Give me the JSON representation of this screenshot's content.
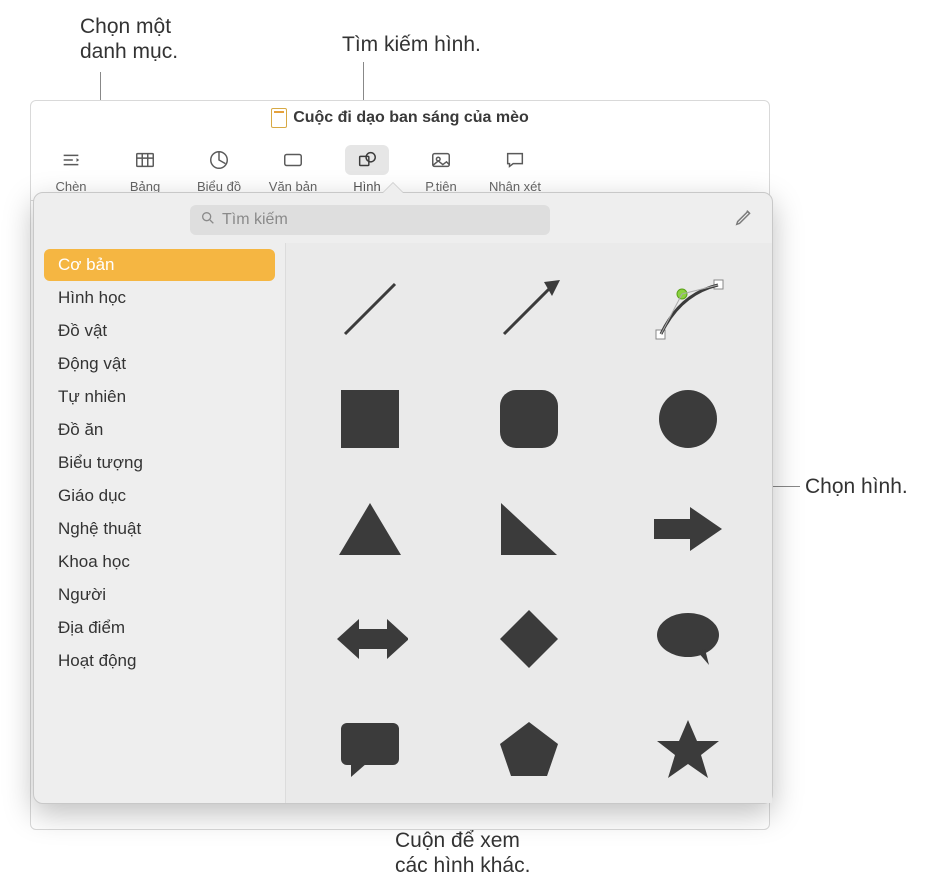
{
  "callouts": {
    "category": "Chọn một\ndanh mục.",
    "search": "Tìm kiếm hình.",
    "choose": "Chọn hình.",
    "scroll": "Cuộn để xem\ncác hình khác."
  },
  "document_title": "Cuộc đi dạo ban sáng của mèo",
  "toolbar": {
    "insert": "Chèn",
    "table": "Bảng",
    "chart": "Biểu đồ",
    "text": "Văn bản",
    "shape": "Hình",
    "media": "P.tiện",
    "comment": "Nhận xét"
  },
  "search": {
    "placeholder": "Tìm kiếm"
  },
  "categories": [
    "Cơ bản",
    "Hình học",
    "Đồ vật",
    "Động vật",
    "Tự nhiên",
    "Đồ ăn",
    "Biểu tượng",
    "Giáo dục",
    "Nghệ thuật",
    "Khoa học",
    "Người",
    "Địa điểm",
    "Hoạt động"
  ],
  "selected_category_index": 0,
  "shapes": [
    "line",
    "arrow-line",
    "curve",
    "square",
    "rounded-square",
    "circle",
    "triangle",
    "right-triangle",
    "arrow-right",
    "arrow-leftright",
    "diamond",
    "speech-bubble",
    "callout-rect",
    "pentagon",
    "star"
  ]
}
